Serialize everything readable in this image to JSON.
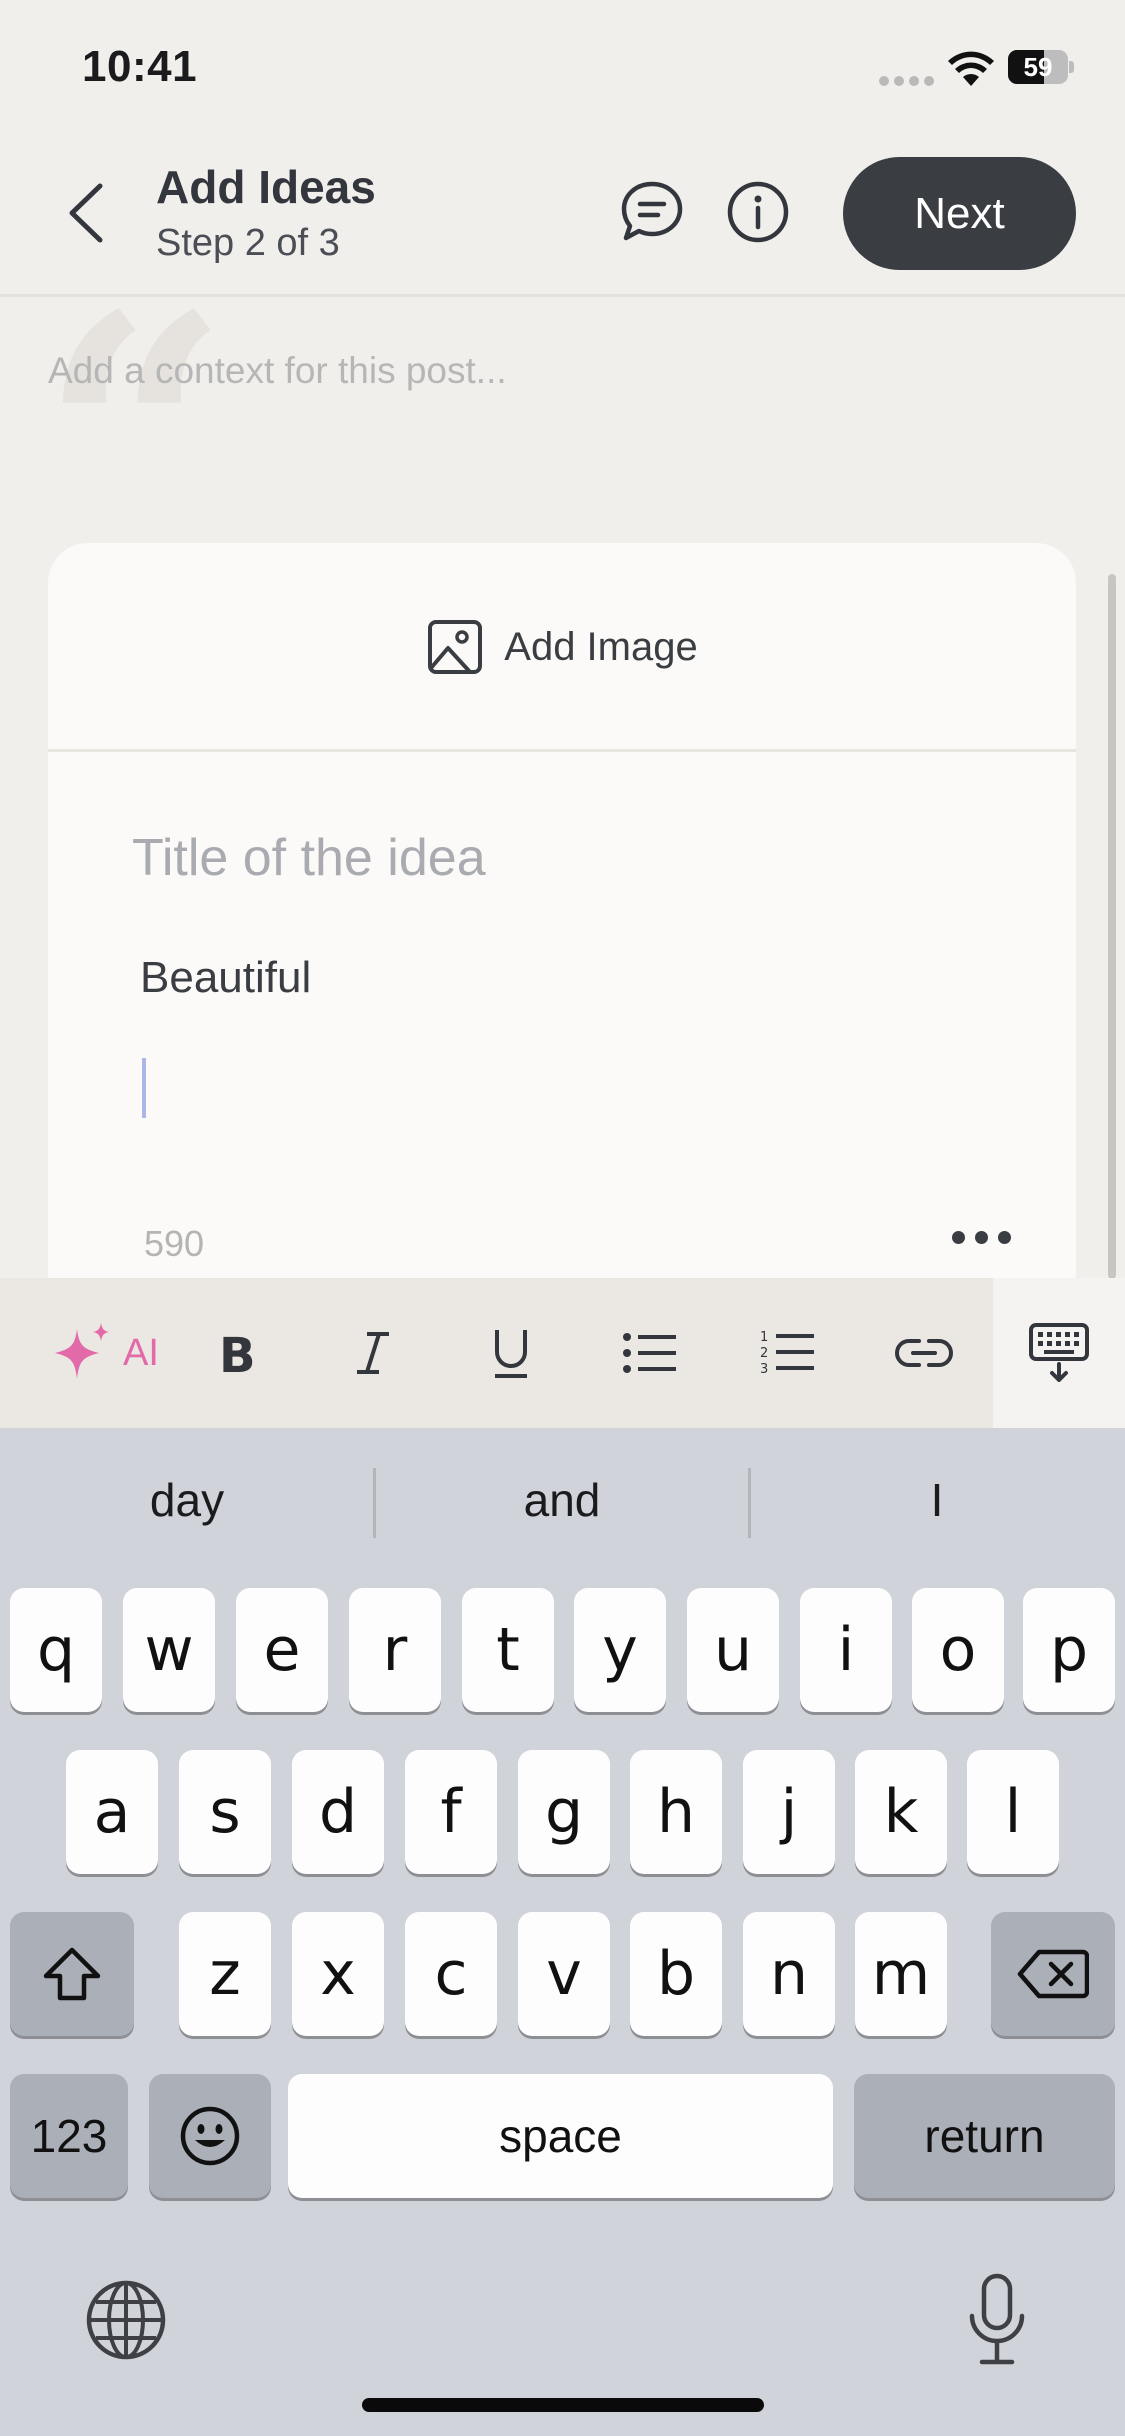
{
  "status_bar": {
    "time": "10:41",
    "battery": "59"
  },
  "header": {
    "title": "Add Ideas",
    "subtitle": "Step 2 of 3",
    "next_label": "Next"
  },
  "context": {
    "placeholder": "Add a context for this post..."
  },
  "card": {
    "add_image_label": "Add Image",
    "title_placeholder": "Title of the idea",
    "body_text": "Beautiful",
    "char_count": "590"
  },
  "toolbar": {
    "ai_label": "AI"
  },
  "keyboard": {
    "suggestions": [
      "day",
      "and",
      "I"
    ],
    "row1": [
      "q",
      "w",
      "e",
      "r",
      "t",
      "y",
      "u",
      "i",
      "o",
      "p"
    ],
    "row2": [
      "a",
      "s",
      "d",
      "f",
      "g",
      "h",
      "j",
      "k",
      "l"
    ],
    "row3": [
      "z",
      "x",
      "c",
      "v",
      "b",
      "n",
      "m"
    ],
    "numbers_label": "123",
    "space_label": "space",
    "return_label": "return"
  },
  "colors": {
    "accent_pink": "#e26aa9",
    "next_button_bg": "#3a3d42",
    "background": "#f1efec"
  }
}
